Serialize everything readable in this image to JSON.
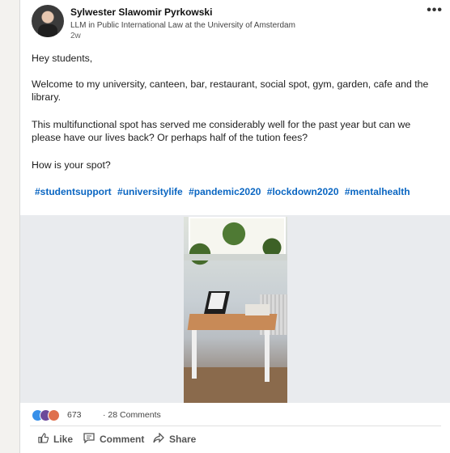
{
  "post": {
    "author": "Sylwester Slawomir Pyrkowski",
    "headline": "LLM in Public International Law at the University of Amsterdam",
    "time": "2w",
    "more": "•••",
    "paragraphs": [
      "Hey students,",
      "Welcome to my university, canteen, bar, restaurant, social spot, gym, garden, cafe and the library.",
      "This multifunctional spot has served me considerably well for the past year but can we please have our lives back? Or perhaps half of the tution fees?",
      "How is your spot?"
    ],
    "hashtags": [
      "#studentsupport",
      "#universitylife",
      "#pandemic2020",
      "#lockdown2020",
      "#mentalhealth"
    ]
  },
  "social": {
    "reaction_count": "673",
    "separator": "·",
    "comments": "28 Comments"
  },
  "actions": {
    "like": "Like",
    "comment": "Comment",
    "share": "Share"
  },
  "icons": {
    "like": "thumbs-up-icon",
    "comment": "comment-icon",
    "share": "share-arrow-icon"
  },
  "colors": {
    "hashtag": "#0a66c2",
    "like_reaction": "#378fe9",
    "support_reaction": "#6c4a9a",
    "love_reaction": "#df704d"
  }
}
